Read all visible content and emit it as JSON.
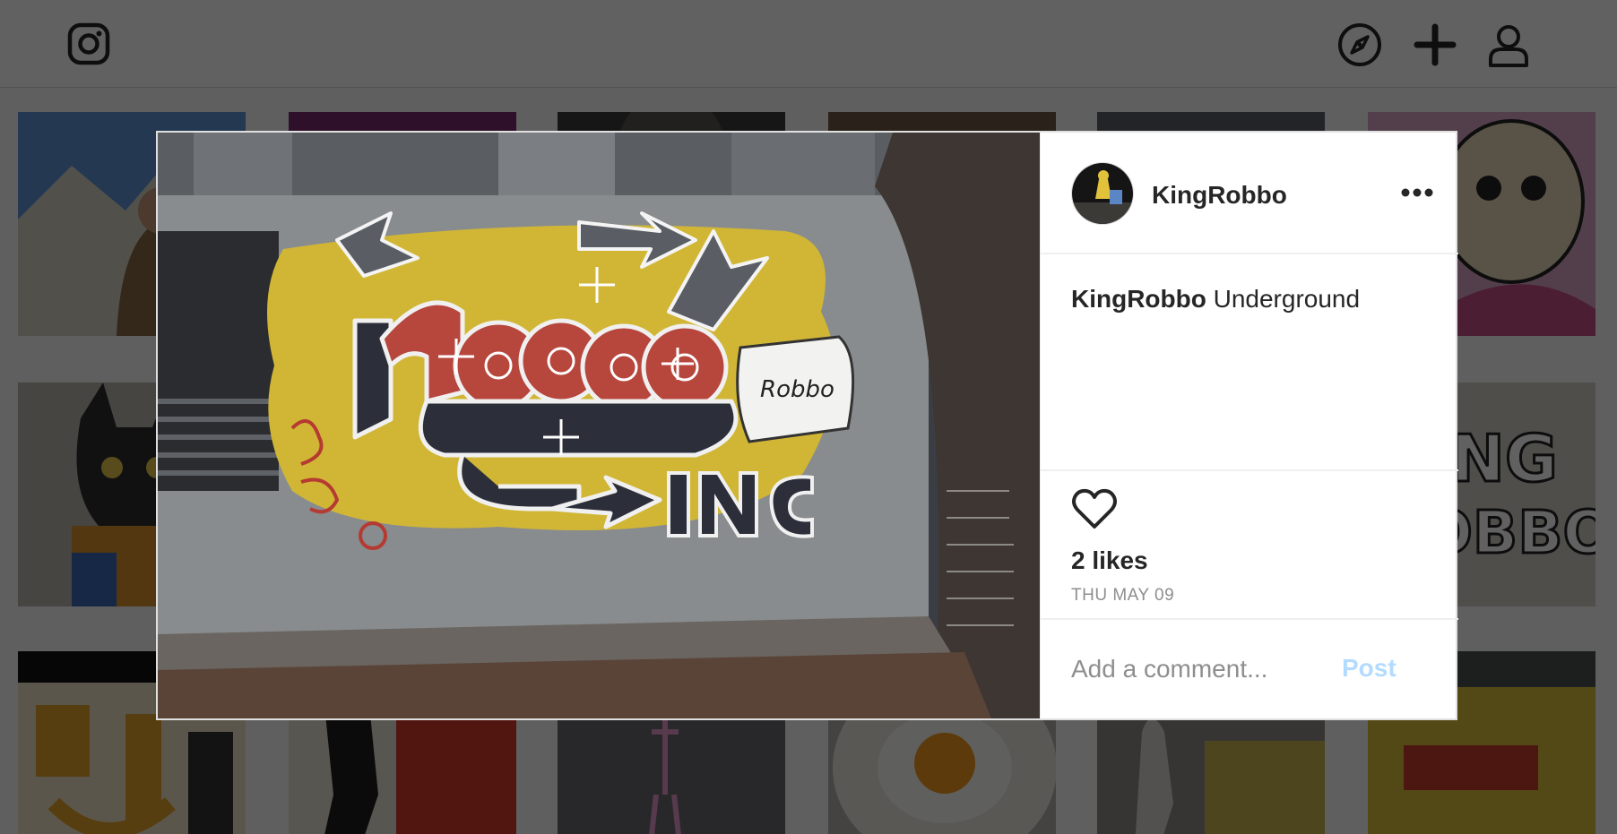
{
  "header": {
    "logo_icon": "instagram-icon",
    "nav": [
      "compass-icon",
      "plus-icon",
      "user-icon"
    ]
  },
  "modal": {
    "owner": "KingRobbo",
    "caption_user": "KingRobbo",
    "caption_text": " Underground",
    "likes": "2 likes",
    "date": "THU MAY 09",
    "comment_placeholder": "Add a comment...",
    "post_label": "Post",
    "like_icon": "heart-outline-icon",
    "more_icon": "more-options-icon"
  },
  "colors": {
    "post_disabled": "#b3dbff",
    "muted": "#8e8e8e",
    "text": "#262626"
  }
}
